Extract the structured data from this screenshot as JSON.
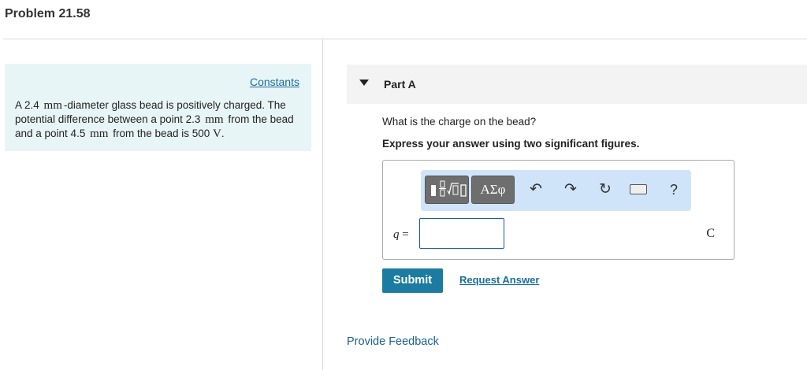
{
  "page": {
    "title": "Problem 21.58"
  },
  "left_panel": {
    "constants_label": "Constants",
    "problem": {
      "p1": "A 2.4",
      "u1": "mm",
      "p2": "-diameter glass bead is positively charged. The potential difference between a point 2.3",
      "u2": "mm",
      "p3": "from the bead and a point 4.5",
      "u3": "mm",
      "p4": "from the bead is 500",
      "u4": "V",
      "p5": "."
    }
  },
  "part": {
    "title": "Part A",
    "question": "What is the charge on the bead?",
    "instruction": "Express your answer using two significant figures."
  },
  "answer": {
    "variable": "q",
    "equals": "=",
    "value": "",
    "unit": "C"
  },
  "toolbar": {
    "greek_label": "ΑΣφ",
    "undo_glyph": "↶",
    "redo_glyph": "↷",
    "reset_glyph": "↻",
    "help_glyph": "?"
  },
  "actions": {
    "submit_label": "Submit",
    "request_answer_label": "Request Answer",
    "feedback_label": "Provide Feedback"
  },
  "colors": {
    "left_panel_bg": "#e8f5f7",
    "submit_bg": "#1b7ba0",
    "link": "#1a6e9c",
    "toolbar_bg": "#cfe4f9"
  }
}
